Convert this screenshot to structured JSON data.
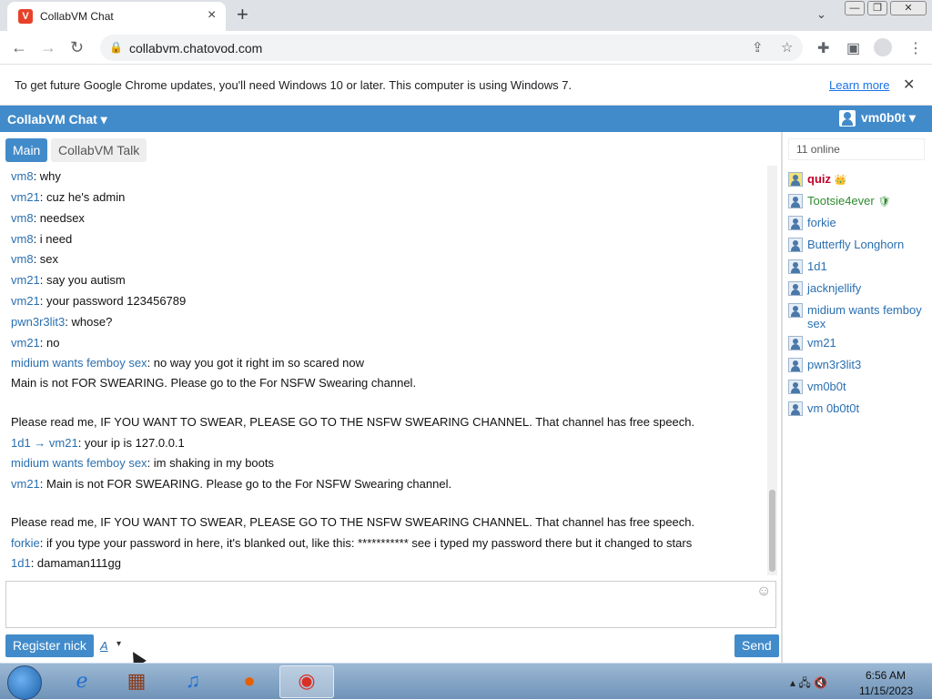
{
  "browser": {
    "tab_title": "CollabVM Chat",
    "tab_favicon": "V",
    "close_tab": "×",
    "new_tab": "+",
    "tab_search": "⌄",
    "win_min": "—",
    "win_max": "❐",
    "win_close": "✕",
    "back": "←",
    "forward": "→",
    "reload": "↻",
    "url": "collabvm.chatovod.com",
    "infobar_text": "To get future Google Chrome updates, you'll need Windows 10 or later. This computer is using Windows 7.",
    "infobar_link": "Learn more",
    "infobar_close": "✕"
  },
  "chat": {
    "brand": "CollabVM Chat ▾",
    "current_user": "vm0b0t ▾",
    "tabs": [
      {
        "label": "Main"
      },
      {
        "label": "CollabVM Talk"
      }
    ],
    "messages": [
      {
        "nick": "vm8",
        "text": ": why"
      },
      {
        "nick": "vm21",
        "text": ": cuz he's admin"
      },
      {
        "nick": "vm8",
        "text": ": needsex"
      },
      {
        "nick": "vm8",
        "text": ": i need"
      },
      {
        "nick": "vm8",
        "text": ": sex"
      },
      {
        "nick": "vm21",
        "text": ": say you autism"
      },
      {
        "nick": "vm21",
        "text": ": your password 123456789"
      },
      {
        "nick": "pwn3r3lit3",
        "text": ": whose?"
      },
      {
        "nick": "vm21",
        "text": ": no"
      },
      {
        "nick": "midium wants femboy sex",
        "text": ": no way you got it right im so scared now"
      },
      {
        "nick": "",
        "text": "Main is not FOR SWEARING. Please go to the For NSFW Swearing channel."
      },
      {
        "nick": "",
        "text": "Please read me, IF YOU WANT TO SWEAR, PLEASE GO TO THE NSFW SWEARING CHANNEL. That channel has free speech."
      },
      {
        "nick": "1d1 → vm21",
        "text": ": your ip is 127.0.0.1"
      },
      {
        "nick": "midium wants femboy sex",
        "text": ": im shaking in my boots"
      },
      {
        "nick": "vm21",
        "text": ": Main is not FOR SWEARING. Please go to the For NSFW Swearing channel."
      },
      {
        "nick": "",
        "text": "Please read me, IF YOU WANT TO SWEAR, PLEASE GO TO THE NSFW SWEARING CHANNEL. That channel has free speech."
      },
      {
        "nick": "forkie",
        "text": ": if you type your password in here, it's blanked out, like this: *********** see i typed my password there but it changed to stars"
      },
      {
        "nick": "1d1",
        "text": ": damaman111gg"
      }
    ],
    "emoji": "☺",
    "register_button": "Register nick",
    "format_button": "A",
    "format_caret": "▾",
    "send_button": "Send"
  },
  "sidebar": {
    "online_count": "11 online",
    "users": [
      {
        "name": "quiz",
        "role": "owner",
        "badge": "👑"
      },
      {
        "name": "Tootsie4ever",
        "role": "mod",
        "badge": "🛡"
      },
      {
        "name": "forkie",
        "role": "user",
        "badge": ""
      },
      {
        "name": "Butterfly Longhorn",
        "role": "user",
        "badge": ""
      },
      {
        "name": "1d1",
        "role": "user",
        "badge": ""
      },
      {
        "name": "jacknjellify",
        "role": "user",
        "badge": ""
      },
      {
        "name": "midium wants femboy sex",
        "role": "user",
        "badge": ""
      },
      {
        "name": "vm21",
        "role": "user",
        "badge": ""
      },
      {
        "name": "pwn3r3lit3",
        "role": "user",
        "badge": ""
      },
      {
        "name": "vm0b0t",
        "role": "user",
        "badge": ""
      },
      {
        "name": "vm 0b0t0t",
        "role": "user",
        "badge": ""
      }
    ]
  },
  "taskbar": {
    "icons": [
      "ie-icon",
      "store-icon",
      "music-icon",
      "firefox-icon",
      "chrome-icon"
    ],
    "tray": "▴  🖧  🔇",
    "time": "6:56 AM",
    "date": "11/15/2023"
  }
}
